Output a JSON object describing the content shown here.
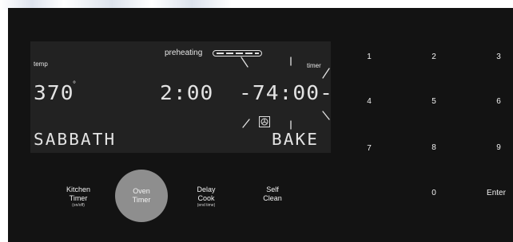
{
  "display": {
    "preheating_label": "preheating",
    "temp_label": "temp",
    "temp_value": "370",
    "degree_symbol": "°",
    "cook_time": "2:00",
    "timer_label": "timer",
    "timer_value": "-74:00-",
    "mode_left": "SABBATH",
    "mode_right": "BAKE",
    "fan_icon": "convection-fan-icon"
  },
  "function_keys": [
    {
      "line1": "Kitchen",
      "line2": "Timer",
      "sub": "(on/off)"
    },
    {
      "line1": "Oven",
      "line2": "Timer",
      "sub": ""
    },
    {
      "line1": "Delay",
      "line2": "Cook",
      "sub": "(end time)"
    },
    {
      "line1": "Self",
      "line2": "Clean",
      "sub": ""
    }
  ],
  "keypad": [
    "1",
    "2",
    "3",
    "4",
    "5",
    "6",
    "7",
    "8",
    "9",
    "0",
    "Enter"
  ],
  "colors": {
    "panel": "#131313",
    "lcd": "#222222",
    "text": "#e3e3e3",
    "oven_timer_highlight": "#8e8e8e"
  }
}
